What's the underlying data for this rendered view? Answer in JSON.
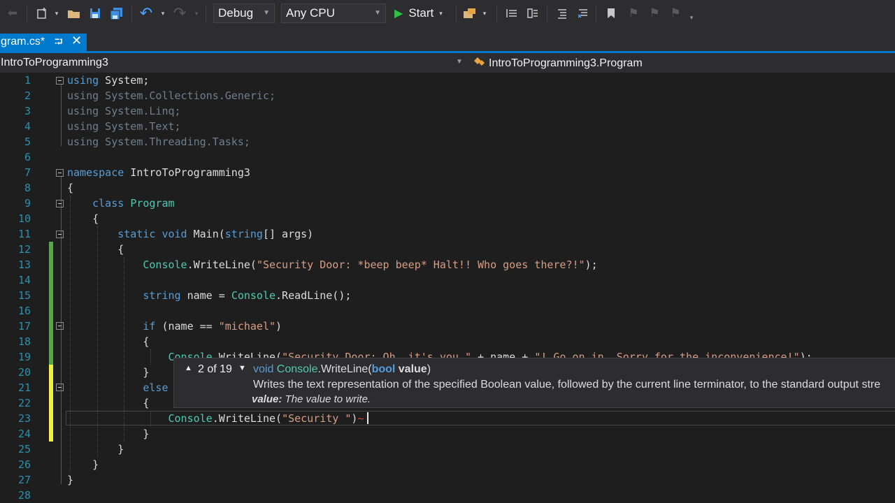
{
  "toolbar": {
    "config": "Debug",
    "platform": "Any CPU",
    "start_label": "Start"
  },
  "tab": {
    "label": "gram.cs*"
  },
  "navbar": {
    "project": "IntroToProgramming3",
    "class_path": "IntroToProgramming3.Program"
  },
  "editor": {
    "line_numbers": [
      "1",
      "2",
      "3",
      "4",
      "5",
      "6",
      "7",
      "8",
      "9",
      "10",
      "11",
      "12",
      "13",
      "14",
      "15",
      "16",
      "17",
      "18",
      "19",
      "20",
      "21",
      "22",
      "23",
      "24",
      "25",
      "26",
      "27",
      "28"
    ]
  },
  "signature_help": {
    "counter": "2 of 19",
    "signature_prefix": "void ",
    "signature_type": "Console",
    "signature_method": ".WriteLine(",
    "signature_param_type": "bool",
    "signature_param": " value",
    "signature_close": ")",
    "description": "Writes the text representation of the specified Boolean value, followed by the current line terminator, to the standard output stre",
    "param_name": "value:",
    "param_desc": "The value to write."
  },
  "colors": {
    "accent": "#007acc",
    "keyword": "#569cd6",
    "type": "#4ec9b0",
    "string": "#d69d85",
    "line_number": "#2b91af",
    "changed_saved": "#57a64a",
    "changed_unsaved": "#efef3f"
  }
}
